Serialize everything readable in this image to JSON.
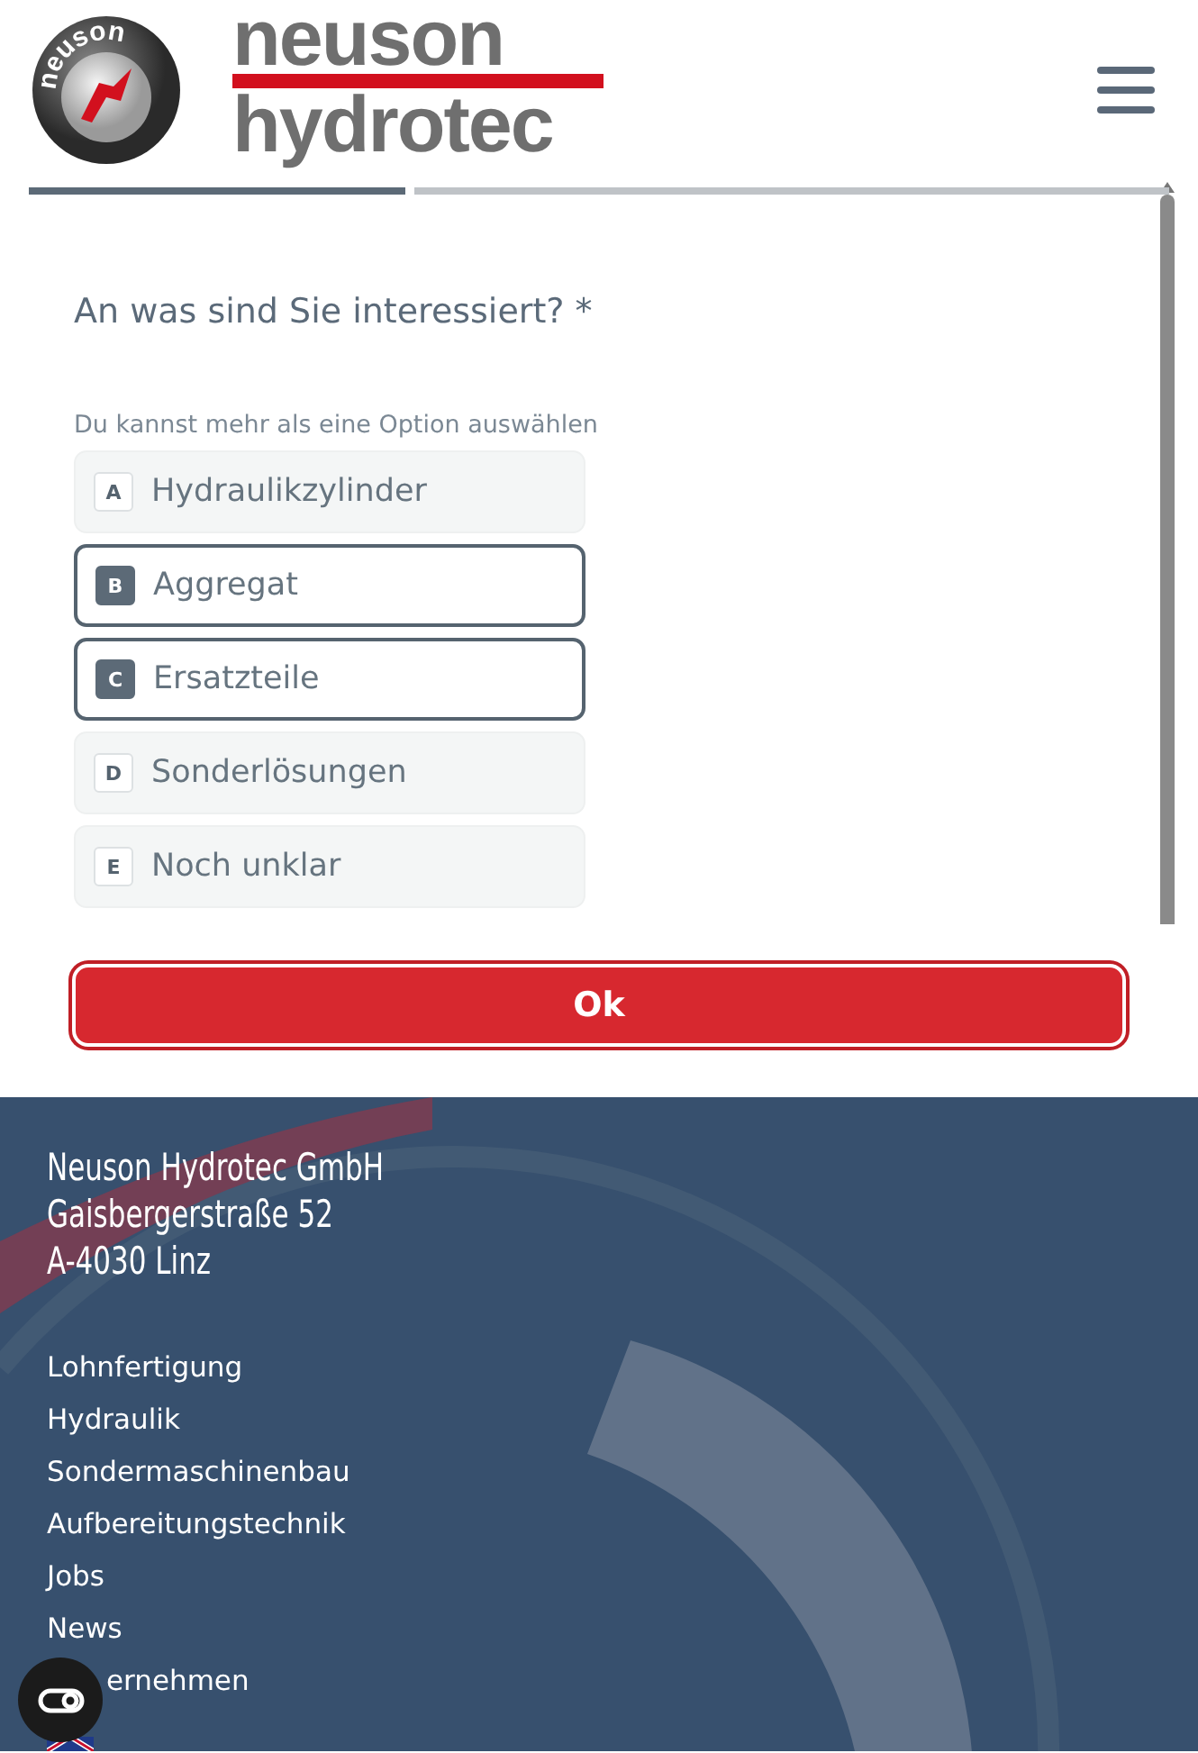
{
  "header": {
    "logo_badge_text": "neuson",
    "logo_line_1": "neuson",
    "logo_line_2": "hydrotec"
  },
  "progress": {
    "level": 0.33
  },
  "question": {
    "title": "An was sind Sie interessiert? *",
    "hint": "Du kannst mehr als eine Option auswählen",
    "options": [
      {
        "key": "A",
        "label": "Hydraulikzylinder",
        "selected": false
      },
      {
        "key": "B",
        "label": "Aggregat",
        "selected": true
      },
      {
        "key": "C",
        "label": "Ersatzteile",
        "selected": true
      },
      {
        "key": "D",
        "label": "Sonderlösungen",
        "selected": false
      },
      {
        "key": "E",
        "label": "Noch unklar",
        "selected": false
      }
    ],
    "submit": "Ok"
  },
  "footer": {
    "address": [
      "Neuson Hydrotec GmbH",
      "Gaisbergerstraße 52",
      "A-4030 Linz"
    ],
    "links": [
      "Lohnfertigung",
      "Hydraulik",
      "Sondermaschinenbau",
      "Aufbereitungstechnik",
      "Jobs",
      "News",
      "ernehmen"
    ]
  }
}
